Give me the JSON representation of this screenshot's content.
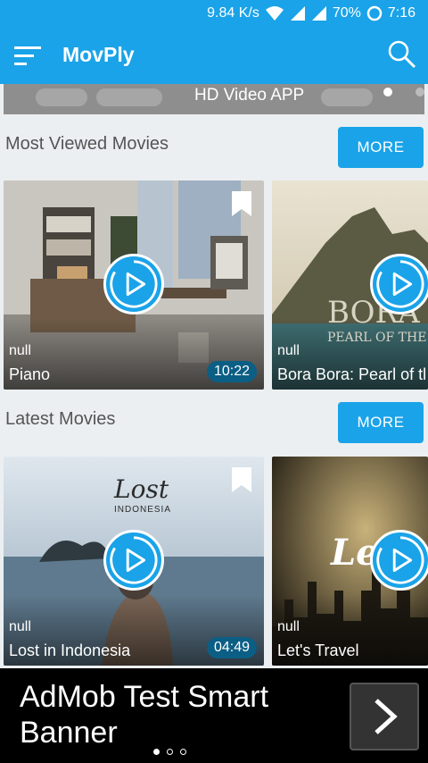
{
  "status_bar": {
    "network_speed": "9.84 K/s",
    "battery": "70%",
    "time": "7:16"
  },
  "app_bar": {
    "title": "MovPly"
  },
  "promo_banner": {
    "text": "HD Video APP"
  },
  "sections": [
    {
      "title": "Most Viewed Movies",
      "more_label": "MORE",
      "movies": [
        {
          "subtitle": "null",
          "title": "Piano",
          "duration": "10:22"
        },
        {
          "subtitle": "null",
          "title": "Bora Bora: Pearl of tl",
          "overlay_title": "BORA BORA",
          "overlay_subtitle": "PEARL OF THE PACIFIC"
        }
      ]
    },
    {
      "title": "Latest Movies",
      "more_label": "MORE",
      "movies": [
        {
          "subtitle": "null",
          "title": "Lost in Indonesia",
          "duration": "04:49",
          "overlay_title": "Lost",
          "overlay_subtitle": "INDONESIA"
        },
        {
          "subtitle": "null",
          "title": "Let's Travel",
          "overlay_title": "Let'"
        }
      ]
    }
  ],
  "ad_banner": {
    "text": "AdMob Test Smart Banner"
  },
  "colors": {
    "primary": "#1aa3e8",
    "more_button": "#1aa3e8",
    "duration_badge": "#0b5e84"
  }
}
